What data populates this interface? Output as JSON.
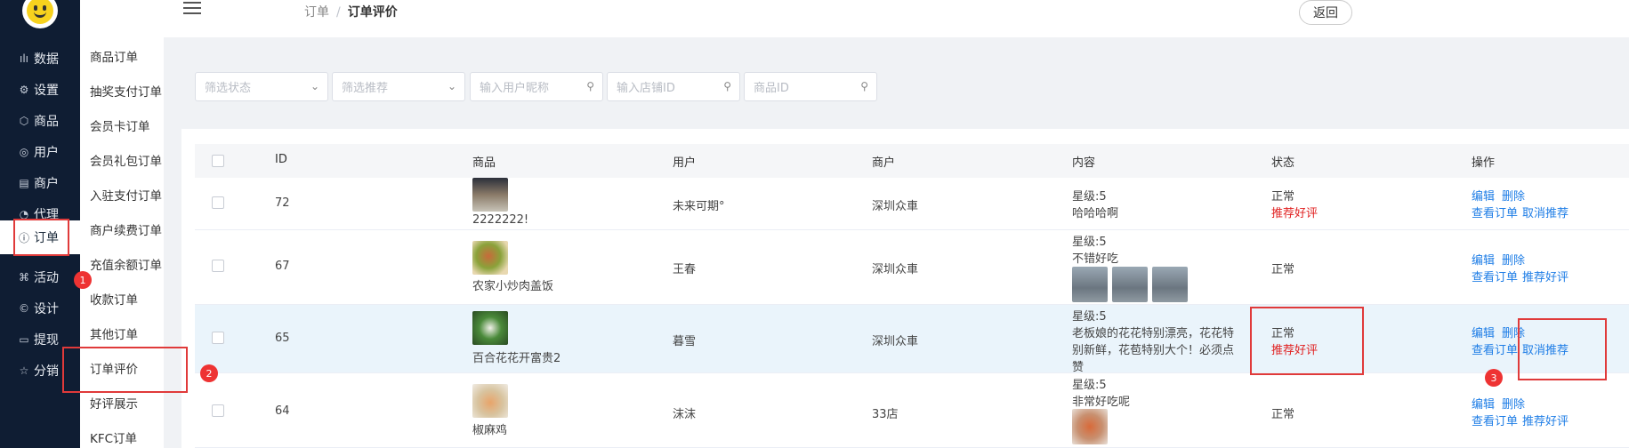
{
  "sidebar": {
    "items": [
      {
        "label": "数据",
        "icon": "bar-chart-icon",
        "glyph": "ılı"
      },
      {
        "label": "设置",
        "icon": "gear-icon",
        "glyph": "⚙"
      },
      {
        "label": "商品",
        "icon": "cube-icon",
        "glyph": "⬡"
      },
      {
        "label": "用户",
        "icon": "user-icon",
        "glyph": "◎"
      },
      {
        "label": "商户",
        "icon": "document-icon",
        "glyph": "▤"
      },
      {
        "label": "代理",
        "icon": "pie-icon",
        "glyph": "◔"
      },
      {
        "label": "订单",
        "icon": "info-icon",
        "glyph": "ⓘ"
      },
      {
        "label": "活动",
        "icon": "tag-icon",
        "glyph": "⌘"
      },
      {
        "label": "设计",
        "icon": "copyright-icon",
        "glyph": "©"
      },
      {
        "label": "提现",
        "icon": "card-icon",
        "glyph": "▭"
      },
      {
        "label": "分销",
        "icon": "star-icon",
        "glyph": "☆"
      }
    ]
  },
  "submenu": {
    "items": [
      "商品订单",
      "抽奖支付订单",
      "会员卡订单",
      "会员礼包订单",
      "入驻支付订单",
      "商户续费订单",
      "充值余额订单",
      "收款订单",
      "其他订单",
      "订单评价",
      "好评展示",
      "KFC订单"
    ]
  },
  "topbar": {
    "breadcrumb_parent": "订单",
    "breadcrumb_sep": "/",
    "breadcrumb_current": "订单评价",
    "back_label": "返回"
  },
  "filters": {
    "status_placeholder": "筛选状态",
    "recommend_placeholder": "筛选推荐",
    "nickname_placeholder": "输入用户昵称",
    "shop_placeholder": "输入店铺ID",
    "product_placeholder": "商品ID"
  },
  "table": {
    "headers": [
      "ID",
      "商品",
      "用户",
      "商户",
      "内容",
      "状态",
      "操作"
    ],
    "rows": [
      {
        "id": "72",
        "product": "2222222!",
        "user": "未来可期°",
        "merchant": "深圳众車",
        "rating": "星级:5",
        "content": "哈哈哈啊",
        "status": "正常",
        "status2": "推荐好评",
        "op_edit": "编辑",
        "op_delete": "删除",
        "op_view": "查看订单",
        "op_rec": "取消推荐"
      },
      {
        "id": "67",
        "product": "农家小炒肉盖饭",
        "user": "王春",
        "merchant": "深圳众車",
        "rating": "星级:5",
        "content": "不错好吃",
        "status": "正常",
        "status2": "",
        "op_edit": "编辑",
        "op_delete": "删除",
        "op_view": "查看订单",
        "op_rec": "推荐好评"
      },
      {
        "id": "65",
        "product": "百合花花开富贵2",
        "user": "暮雪",
        "merchant": "深圳众車",
        "rating": "星级:5",
        "content_l1": "老板娘的花花特别漂亮，花花特",
        "content_l2": "别新鲜，花苞特别大个！必须点",
        "content_l3": "赞",
        "status": "正常",
        "status2": "推荐好评",
        "op_edit": "编辑",
        "op_delete": "删除",
        "op_view": "查看订单",
        "op_rec": "取消推荐"
      },
      {
        "id": "64",
        "product": "椒麻鸡",
        "user": "沫沫",
        "merchant": "33店",
        "rating": "星级:5",
        "content": "非常好吃呢",
        "status": "正常",
        "status2": "",
        "op_edit": "编辑",
        "op_delete": "删除",
        "op_view": "查看订单",
        "op_rec": "推荐好评"
      }
    ]
  },
  "annotations": {
    "b1": "1",
    "b2": "2",
    "b3": "3"
  },
  "colors": {
    "sidebar": "#0f1d33",
    "link": "#1e7de6",
    "alert_red": "#e02020",
    "annotation_red": "#e03a3a"
  }
}
